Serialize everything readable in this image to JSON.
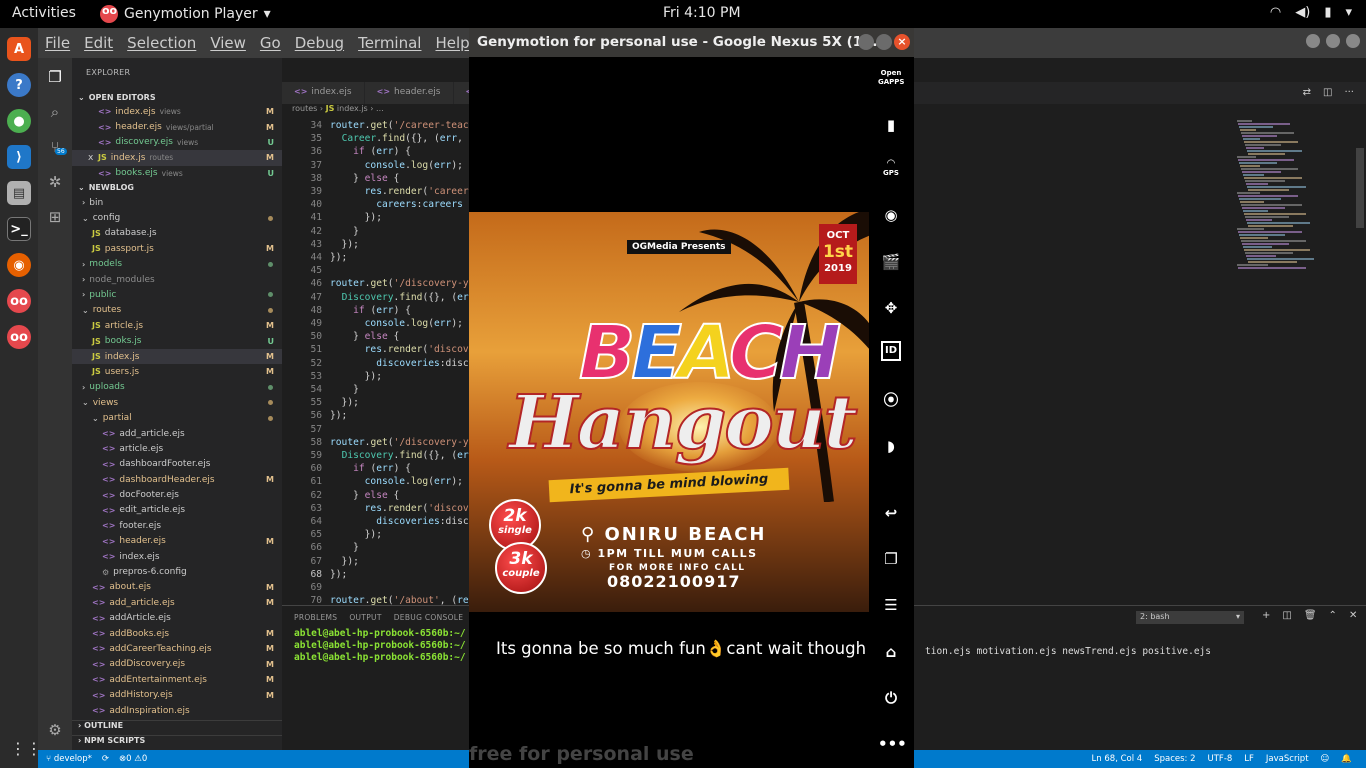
{
  "topbar": {
    "activities": "Activities",
    "app_name": "Genymotion Player",
    "clock": "Fri  4:10 PM"
  },
  "vscode": {
    "menu": [
      "File",
      "Edit",
      "Selection",
      "View",
      "Go",
      "Debug",
      "Terminal",
      "Help"
    ],
    "scm_badge": "56",
    "explorer_label": "EXPLORER",
    "open_editors_label": "OPEN EDITORS",
    "open_editors": [
      {
        "name": "index.ejs",
        "dir": "views",
        "kind": "ejs",
        "badge": "M",
        "close": ""
      },
      {
        "name": "header.ejs",
        "dir": "views/partial",
        "kind": "ejs",
        "badge": "M",
        "close": ""
      },
      {
        "name": "discovery.ejs",
        "dir": "views",
        "kind": "ejs",
        "badge": "U",
        "close": ""
      },
      {
        "name": "index.js",
        "dir": "routes",
        "kind": "js",
        "badge": "M",
        "close": "x"
      },
      {
        "name": "books.ejs",
        "dir": "views",
        "kind": "ejs",
        "badge": "U",
        "close": ""
      }
    ],
    "project_label": "NEWBLOG",
    "tree": [
      {
        "name": "bin",
        "kind": "folder",
        "open": false,
        "depth": 0,
        "badge": "",
        "state": ""
      },
      {
        "name": "config",
        "kind": "folder",
        "open": true,
        "depth": 0,
        "badge": "dot",
        "state": ""
      },
      {
        "name": "database.js",
        "kind": "js",
        "depth": 1,
        "badge": "",
        "state": ""
      },
      {
        "name": "passport.js",
        "kind": "js",
        "depth": 1,
        "badge": "M",
        "state": "mod"
      },
      {
        "name": "models",
        "kind": "folder",
        "open": false,
        "depth": 0,
        "badge": "dotg",
        "state": "new"
      },
      {
        "name": "node_modules",
        "kind": "folder",
        "open": false,
        "depth": 0,
        "badge": "",
        "state": "dim"
      },
      {
        "name": "public",
        "kind": "folder",
        "open": false,
        "depth": 0,
        "badge": "dotg",
        "state": "new"
      },
      {
        "name": "routes",
        "kind": "folder",
        "open": true,
        "depth": 0,
        "badge": "dot",
        "state": "mod"
      },
      {
        "name": "article.js",
        "kind": "js",
        "depth": 1,
        "badge": "M",
        "state": "mod"
      },
      {
        "name": "books.js",
        "kind": "js",
        "depth": 1,
        "badge": "U",
        "state": "new"
      },
      {
        "name": "index.js",
        "kind": "js",
        "depth": 1,
        "badge": "M",
        "state": "mod",
        "selected": true
      },
      {
        "name": "users.js",
        "kind": "js",
        "depth": 1,
        "badge": "M",
        "state": "mod"
      },
      {
        "name": "uploads",
        "kind": "folder",
        "open": false,
        "depth": 0,
        "badge": "dotg",
        "state": "new"
      },
      {
        "name": "views",
        "kind": "folder",
        "open": true,
        "depth": 0,
        "badge": "dot",
        "state": "mod"
      },
      {
        "name": "partial",
        "kind": "folder",
        "open": true,
        "depth": 1,
        "badge": "dot",
        "state": "mod"
      },
      {
        "name": "add_article.ejs",
        "kind": "ejs",
        "depth": 2,
        "badge": "",
        "state": ""
      },
      {
        "name": "article.ejs",
        "kind": "ejs",
        "depth": 2,
        "badge": "",
        "state": ""
      },
      {
        "name": "dashboardFooter.ejs",
        "kind": "ejs",
        "depth": 2,
        "badge": "",
        "state": ""
      },
      {
        "name": "dashboardHeader.ejs",
        "kind": "ejs",
        "depth": 2,
        "badge": "M",
        "state": "mod"
      },
      {
        "name": "docFooter.ejs",
        "kind": "ejs",
        "depth": 2,
        "badge": "",
        "state": ""
      },
      {
        "name": "edit_article.ejs",
        "kind": "ejs",
        "depth": 2,
        "badge": "",
        "state": ""
      },
      {
        "name": "footer.ejs",
        "kind": "ejs",
        "depth": 2,
        "badge": "",
        "state": ""
      },
      {
        "name": "header.ejs",
        "kind": "ejs",
        "depth": 2,
        "badge": "M",
        "state": "mod"
      },
      {
        "name": "index.ejs",
        "kind": "ejs",
        "depth": 2,
        "badge": "",
        "state": ""
      },
      {
        "name": "prepros-6.config",
        "kind": "cfg",
        "depth": 2,
        "badge": "",
        "state": ""
      },
      {
        "name": "about.ejs",
        "kind": "ejs",
        "depth": 1,
        "badge": "M",
        "state": "mod"
      },
      {
        "name": "add_article.ejs",
        "kind": "ejs",
        "depth": 1,
        "badge": "M",
        "state": "mod"
      },
      {
        "name": "addArticle.ejs",
        "kind": "ejs",
        "depth": 1,
        "badge": "",
        "state": ""
      },
      {
        "name": "addBooks.ejs",
        "kind": "ejs",
        "depth": 1,
        "badge": "M",
        "state": "mod"
      },
      {
        "name": "addCareerTeaching.ejs",
        "kind": "ejs",
        "depth": 1,
        "badge": "M",
        "state": "mod"
      },
      {
        "name": "addDiscovery.ejs",
        "kind": "ejs",
        "depth": 1,
        "badge": "M",
        "state": "mod"
      },
      {
        "name": "addEntertainment.ejs",
        "kind": "ejs",
        "depth": 1,
        "badge": "M",
        "state": "mod"
      },
      {
        "name": "addHistory.ejs",
        "kind": "ejs",
        "depth": 1,
        "badge": "M",
        "state": "mod"
      },
      {
        "name": "addInspiration.ejs",
        "kind": "ejs",
        "depth": 1,
        "badge": "",
        "state": "mod"
      }
    ],
    "outline_label": "OUTLINE",
    "npm_label": "NPM SCRIPTS",
    "tabs": [
      {
        "name": "index.ejs",
        "kind": "ejs"
      },
      {
        "name": "header.ejs",
        "kind": "ejs"
      },
      {
        "name": "",
        "kind": "ejs"
      }
    ],
    "breadcrumb": {
      "folder": "routes",
      "file": "index.js",
      "rest": "..."
    },
    "code_lines": [
      {
        "n": "34",
        "t": "router.get('/career-teac"
      },
      {
        "n": "35",
        "t": "  Career.find({}, (err,"
      },
      {
        "n": "36",
        "t": "    if (err) {"
      },
      {
        "n": "37",
        "t": "      console.log(err);"
      },
      {
        "n": "38",
        "t": "    } else {"
      },
      {
        "n": "39",
        "t": "      res.render('career"
      },
      {
        "n": "40",
        "t": "        careers:careers"
      },
      {
        "n": "41",
        "t": "      });"
      },
      {
        "n": "42",
        "t": "    }"
      },
      {
        "n": "43",
        "t": "  });"
      },
      {
        "n": "44",
        "t": "});"
      },
      {
        "n": "45",
        "t": ""
      },
      {
        "n": "46",
        "t": "router.get('/discovery-y"
      },
      {
        "n": "47",
        "t": "  Discovery.find({}, (er"
      },
      {
        "n": "48",
        "t": "    if (err) {"
      },
      {
        "n": "49",
        "t": "      console.log(err);"
      },
      {
        "n": "50",
        "t": "    } else {"
      },
      {
        "n": "51",
        "t": "      res.render('discove"
      },
      {
        "n": "52",
        "t": "        discoveries:disc"
      },
      {
        "n": "53",
        "t": "      });"
      },
      {
        "n": "54",
        "t": "    }"
      },
      {
        "n": "55",
        "t": "  });"
      },
      {
        "n": "56",
        "t": "});"
      },
      {
        "n": "57",
        "t": ""
      },
      {
        "n": "58",
        "t": "router.get('/discovery-y"
      },
      {
        "n": "59",
        "t": "  Discovery.find({}, (er"
      },
      {
        "n": "60",
        "t": "    if (err) {"
      },
      {
        "n": "61",
        "t": "      console.log(err);"
      },
      {
        "n": "62",
        "t": "    } else {"
      },
      {
        "n": "63",
        "t": "      res.render('discov"
      },
      {
        "n": "64",
        "t": "        discoveries:disc"
      },
      {
        "n": "65",
        "t": "      });"
      },
      {
        "n": "66",
        "t": "    }"
      },
      {
        "n": "67",
        "t": "  });"
      },
      {
        "n": "68",
        "t": "});"
      },
      {
        "n": "69",
        "t": ""
      },
      {
        "n": "70",
        "t": "router.get('/about', (re"
      }
    ],
    "current_line": "68",
    "panel": {
      "tabs": [
        "PROBLEMS",
        "OUTPUT",
        "DEBUG CONSOLE",
        "T"
      ],
      "terminal_select": "2: bash",
      "terminal_lines": [
        "ablel@abel-hp-probook-6560b:~/",
        "ablel@abel-hp-probook-6560b:~/",
        "ablel@abel-hp-probook-6560b:~/"
      ],
      "terminal_tail": "tion.ejs motivation.ejs newsTrend.ejs positive.ejs"
    },
    "status": {
      "branch": "develop*",
      "errors": "0",
      "warnings": "0",
      "position": "Ln 68, Col 4",
      "spaces": "Spaces: 2",
      "encoding": "UTF-8",
      "eol": "LF",
      "language": "JavaScript"
    }
  },
  "genymotion": {
    "title": "Genymotion for personal use - Google Nexus 5X (1...",
    "watermark": "free for personal use",
    "caption": "Its gonna be so much fun👌cant wait though",
    "flyer": {
      "presents": "OGMedia Presents",
      "date_month": "OCT",
      "date_day": "1st",
      "date_year": "2019",
      "title_letters": [
        "B",
        "E",
        "A",
        "C",
        "H"
      ],
      "title_colors": [
        "#e8316f",
        "#2d6fdc",
        "#f4d21e",
        "#e8316f",
        "#9b3fb8"
      ],
      "subtitle": "Hangout",
      "tagline": "It's gonna be mind blowing",
      "price_single_amount": "2k",
      "price_single_label": "single",
      "price_couple_amount": "3k",
      "price_couple_label": "couple",
      "venue": "ONIRU BEACH",
      "time": "1PM TILL MUM CALLS",
      "info_label": "FOR MORE INFO CALL",
      "phone": "08022100917"
    },
    "toolbar": {
      "open_gapps_line1": "Open",
      "open_gapps_line2": "GAPPS",
      "gps_label": "GPS",
      "id_label": "ID"
    }
  }
}
